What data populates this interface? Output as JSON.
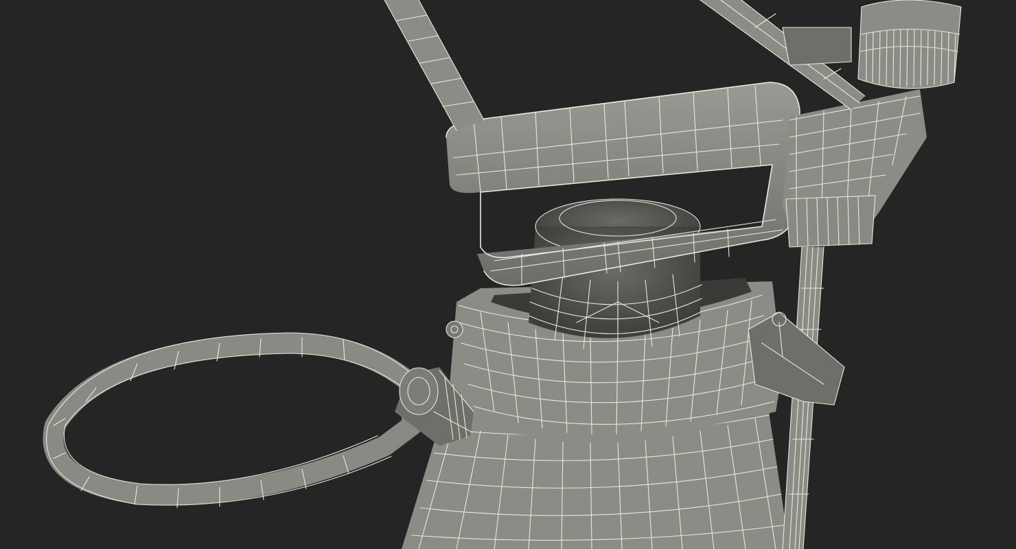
{
  "scene": {
    "subject": "garden-pressure-sprayer-wireframe",
    "render_mode": "wireframe-on-shaded",
    "colors": {
      "background": "#252525",
      "wire": "#e9e9dc",
      "surface_light": "#8c8c86",
      "surface_mid": "#6f6f6a",
      "surface_dark": "#4a4a47",
      "surface_deep": "#3a3a37"
    }
  }
}
